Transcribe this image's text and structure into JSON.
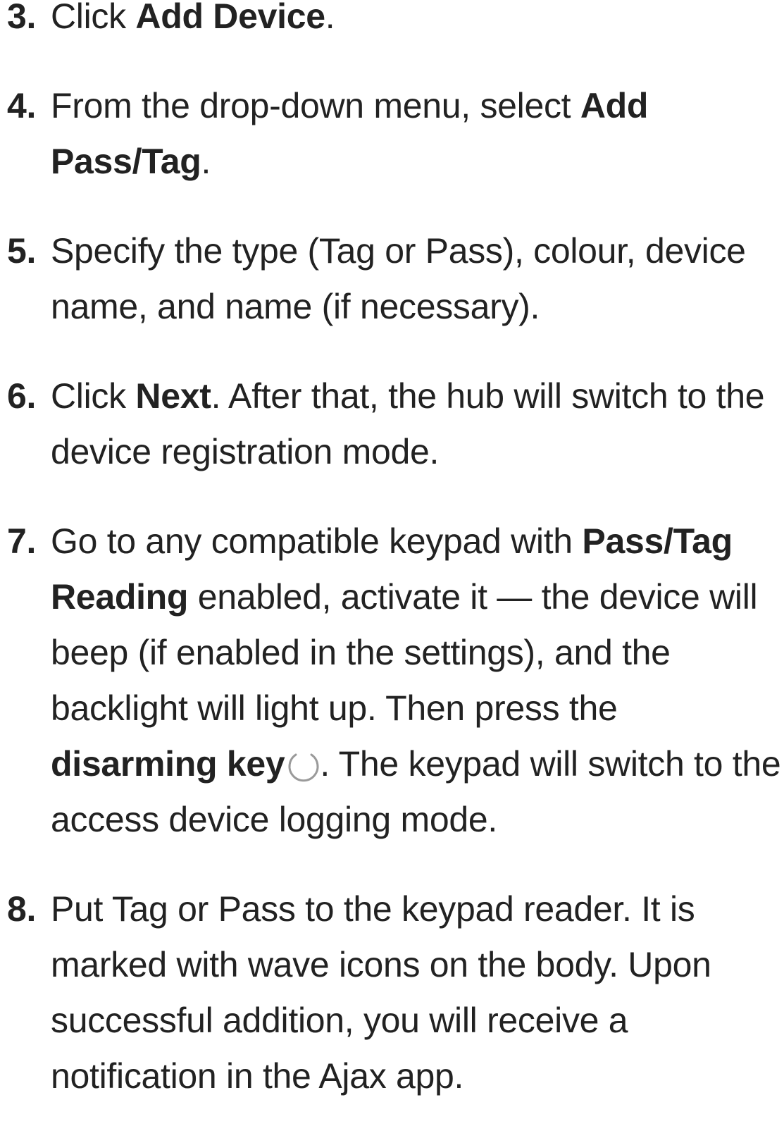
{
  "steps": [
    {
      "number": "3.",
      "text_before": "Click ",
      "bold": "Add Device",
      "text_after": "."
    },
    {
      "number": "4.",
      "text_before": "From the drop-down menu, select ",
      "bold": "Add Pass/Tag",
      "text_after": "."
    },
    {
      "number": "5.",
      "text": "Specify the type (Tag or Pass), colour, device name, and name (if necessary)."
    },
    {
      "number": "6.",
      "text_before": "Click ",
      "bold": "Next",
      "text_after": ". After that, the hub will switch to the device registration mode."
    },
    {
      "number": "7.",
      "text_before": "Go to any compatible keypad with ",
      "bold_1": "Pass/Tag Reading",
      "text_middle": " enabled, activate it — the device will beep (if enabled in the settings), and the backlight will light up. Then press the ",
      "bold_2": "disarming key",
      "icon": "disarm-circle-icon",
      "text_after": ". The keypad will switch to the access device logging mode."
    },
    {
      "number": "8.",
      "text": "Put Tag or Pass to the keypad reader. It is marked with wave icons on the body. Upon successful addition, you will receive a notification in the Ajax app."
    }
  ],
  "colors": {
    "text": "#222222",
    "icon_stroke": "#9a9a9a",
    "background": "#ffffff"
  }
}
